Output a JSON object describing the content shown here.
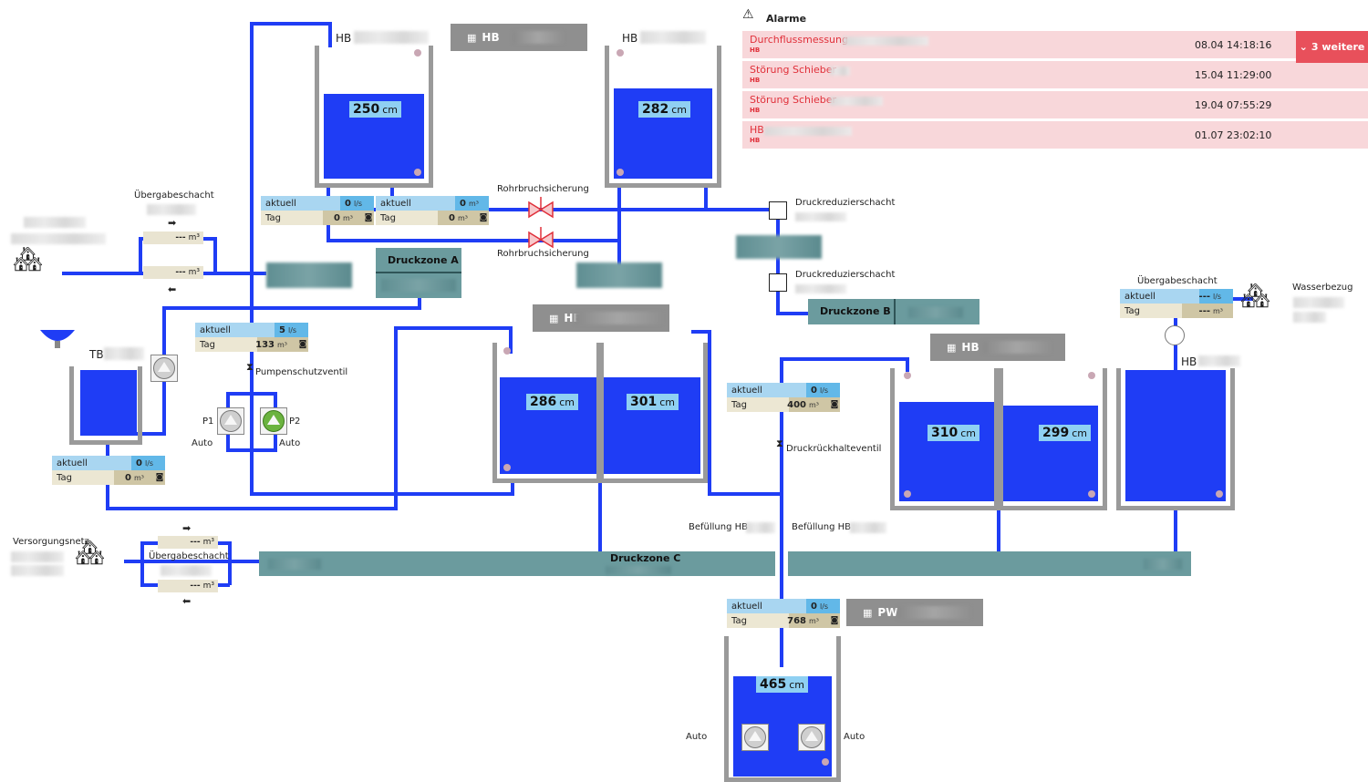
{
  "alarms": {
    "title": "Alarme",
    "more_label": "3 weitere",
    "items": [
      {
        "text": "Durchflussmessung",
        "sub": "HB",
        "time": "08.04 14:18:16"
      },
      {
        "text": "Störung Schieber",
        "sub": "HB",
        "time": "15.04 11:29:00"
      },
      {
        "text": "Störung Schieber",
        "sub": "HB",
        "time": "19.04 07:55:29"
      },
      {
        "text": "HB",
        "sub": "HB",
        "time": "01.07 23:02:10"
      }
    ]
  },
  "labels": {
    "hb": "HB",
    "tb": "TB",
    "uebergabe": "Übergabeschacht",
    "rohrbruch": "Rohrbruchsicherung",
    "druckreduzier": "Druckreduzierschacht",
    "pumpenschutz": "Pumpenschutzventil",
    "druckrueckhalte": "Druckrückhalteventil",
    "befuellung": "Befüllung HB",
    "versorgungsnetz": "Versorgungsnetz",
    "wasserbezug": "Wasserbezug",
    "p1": "P1",
    "p2": "P2",
    "auto": "Auto",
    "pw": "PW"
  },
  "zones": {
    "a": "Druckzone A",
    "b": "Druckzone B",
    "c": "Druckzone C"
  },
  "tanks": {
    "t1": {
      "value": "250",
      "unit": "cm"
    },
    "t2": {
      "value": "282",
      "unit": "cm"
    },
    "t3a": {
      "value": "286",
      "unit": "cm"
    },
    "t3b": {
      "value": "301",
      "unit": "cm"
    },
    "t4a": {
      "value": "310",
      "unit": "cm"
    },
    "t4b": {
      "value": "299",
      "unit": "cm"
    },
    "pw": {
      "value": "465",
      "unit": "cm"
    }
  },
  "meter_labels": {
    "aktuell": "aktuell",
    "tag": "Tag",
    "flow_unit": "l/s",
    "vol_unit": "m³",
    "camera_icon": "camera-icon"
  },
  "meters": {
    "m1": {
      "aktuell": "0",
      "tag": "0"
    },
    "m2": {
      "aktuell": "0",
      "tag": "0"
    },
    "m3": {
      "aktuell": "5",
      "tag": "133"
    },
    "m4": {
      "aktuell": "0",
      "tag": "0"
    },
    "m5": {
      "aktuell": "0",
      "tag": "400"
    },
    "m6": {
      "aktuell": "0",
      "tag": "768"
    },
    "m7": {
      "aktuell": "---",
      "tag": "---"
    }
  },
  "counters": {
    "placeholder": "---",
    "unit": "m³"
  },
  "colors": {
    "pipe": "#1f3df5",
    "water": "#1f3df5",
    "zone": "#6b9b9e",
    "alarm_bg": "#f8d7da",
    "alarm_text": "#e0303a",
    "pump_on": "#6bb33f"
  }
}
